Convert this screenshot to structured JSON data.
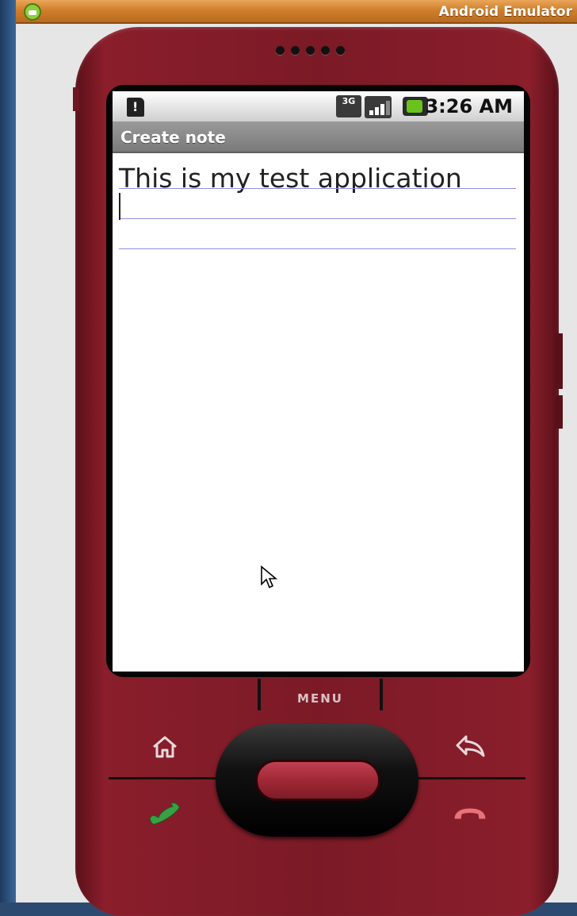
{
  "window": {
    "title": "Android Emulator"
  },
  "status_bar": {
    "network_type": "3G",
    "time": "3:26 AM"
  },
  "app": {
    "title": "Create note",
    "note_text": "This is my test application"
  },
  "controls": {
    "menu_label": "MENU"
  },
  "icons": {
    "app_icon": "android-icon",
    "sim": "sim-alert-icon",
    "network": "3g-data-icon",
    "signal": "signal-strength-icon",
    "battery": "battery-charging-icon",
    "home": "home-icon",
    "back": "back-arrow-icon",
    "call": "call-icon",
    "end_call": "end-call-icon",
    "pointer": "mouse-pointer-icon"
  },
  "colors": {
    "titlebar": "#cf7f2c",
    "phone_body": "#7b1a26",
    "editor_rule": "#8e8ee4",
    "app_titlebar": "#8a8a8a"
  }
}
